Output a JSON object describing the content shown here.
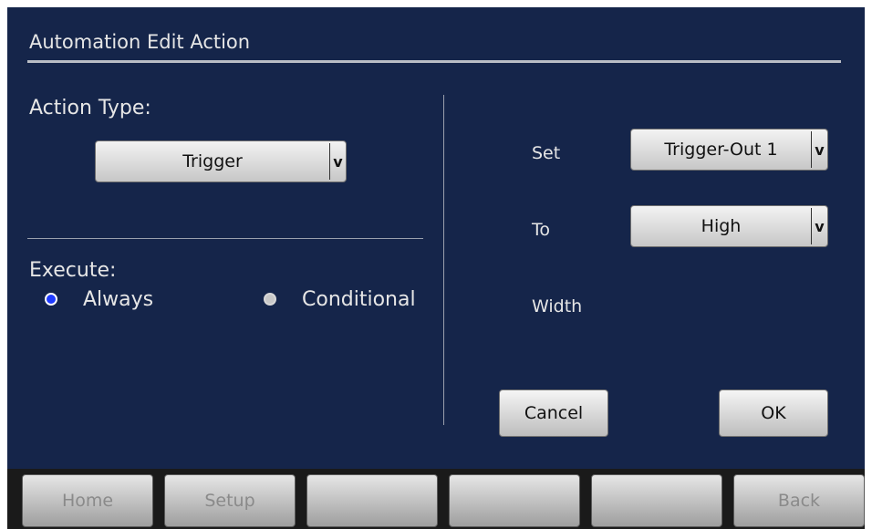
{
  "header": {
    "title": "Automation Edit Action"
  },
  "left": {
    "action_type_label": "Action Type:",
    "action_type_value": "Trigger",
    "execute_label": "Execute:",
    "options": [
      {
        "label": "Always",
        "selected": true
      },
      {
        "label": "Conditional",
        "selected": false
      }
    ]
  },
  "right": {
    "set_label": "Set",
    "set_value": "Trigger-Out 1",
    "to_label": "To",
    "to_value": "High",
    "width_label": "Width"
  },
  "dropdown_arrow": "v",
  "buttons": {
    "cancel": "Cancel",
    "ok": "OK"
  },
  "nav": [
    {
      "label": "Home"
    },
    {
      "label": "Setup"
    },
    {
      "label": ""
    },
    {
      "label": ""
    },
    {
      "label": ""
    },
    {
      "label": "Back"
    }
  ],
  "colors": {
    "background": "#15254a",
    "radio_selected": "#1f3bff",
    "radio_unselected": "#c8c8c8"
  }
}
